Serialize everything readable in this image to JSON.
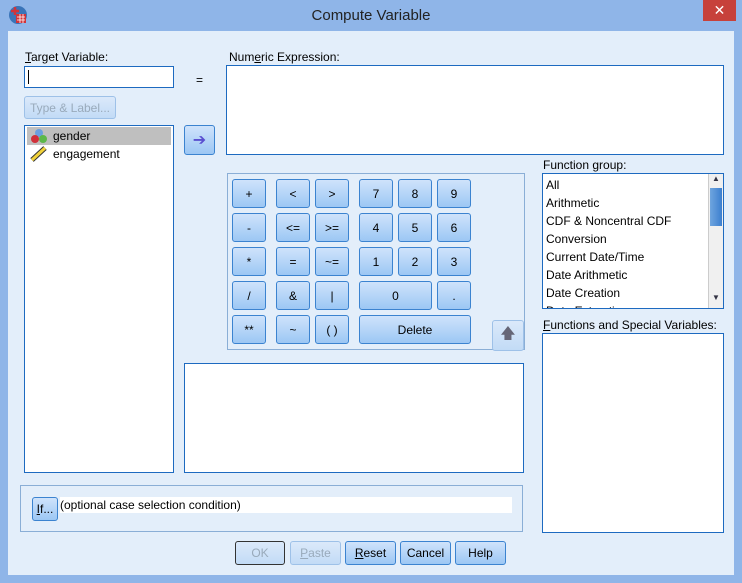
{
  "window": {
    "title": "Compute Variable",
    "close_label": "✕"
  },
  "target": {
    "label_prefix": "",
    "label_u": "T",
    "label_rest": "arget Variable:",
    "value": "",
    "type_label_button": "Type & Label..."
  },
  "equals": "=",
  "expression": {
    "label_a": "Num",
    "label_u": "e",
    "label_b": "ric Expression:",
    "value": ""
  },
  "variables": [
    {
      "name": "gender",
      "icon": "nominal-icon",
      "selected": true
    },
    {
      "name": "engagement",
      "icon": "scale-ruler-icon",
      "selected": false
    }
  ],
  "calculator": {
    "buttons": [
      "+",
      "<",
      ">",
      "7",
      "8",
      "9",
      "-",
      "<=",
      ">=",
      "4",
      "5",
      "6",
      "*",
      "=",
      "~=",
      "1",
      "2",
      "3",
      "/",
      "&",
      "|",
      "0",
      ".",
      "**",
      "~",
      "( )",
      "Delete"
    ]
  },
  "function_group": {
    "label_a": "Function ",
    "label_u": "g",
    "label_b": "roup:",
    "items": [
      "All",
      "Arithmetic",
      "CDF & Noncentral CDF",
      "Conversion",
      "Current Date/Time",
      "Date Arithmetic",
      "Date Creation",
      "Date Extraction"
    ]
  },
  "functions": {
    "label_u": "F",
    "label_b": "unctions and Special Variables:"
  },
  "if_section": {
    "button_u": "I",
    "button_rest": "f...",
    "condition": "(optional case selection condition)"
  },
  "buttons": {
    "ok": "OK",
    "paste_u": "P",
    "paste_rest": "aste",
    "reset_u": "R",
    "reset_rest": "eset",
    "cancel": "Cancel",
    "help": "Help"
  }
}
